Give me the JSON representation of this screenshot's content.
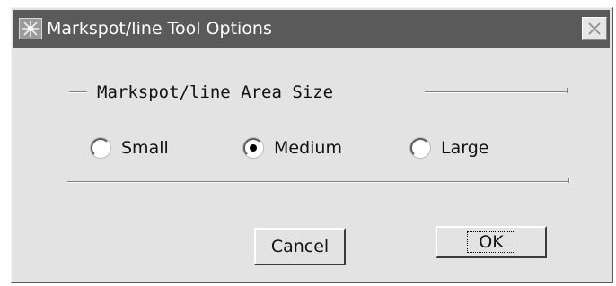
{
  "window": {
    "title": "Markspot/line Tool Options",
    "close_icon": "close-x-icon",
    "app_icon": "app-star-icon"
  },
  "group": {
    "title": "Markspot/line Area Size"
  },
  "options": [
    {
      "label": "Small",
      "selected": false
    },
    {
      "label": "Medium",
      "selected": true
    },
    {
      "label": "Large",
      "selected": false
    }
  ],
  "buttons": {
    "cancel_label": "Cancel",
    "ok_label": "OK"
  },
  "colors": {
    "titlebar": "#5a5a5a",
    "dialog_face": "#e3e3e3"
  }
}
